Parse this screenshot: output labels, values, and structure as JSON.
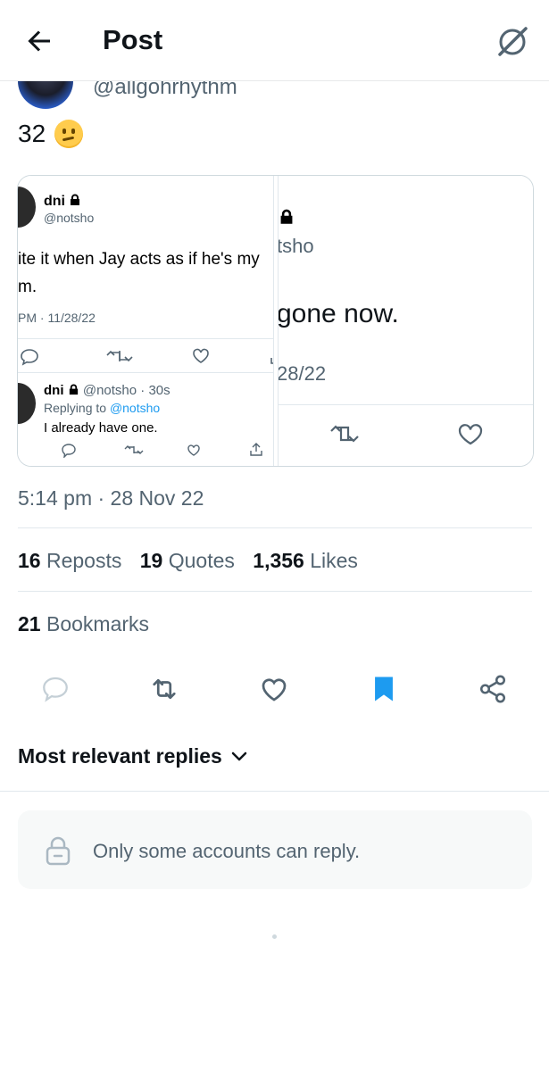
{
  "header": {
    "title": "Post",
    "back_icon": "arrow-left-icon",
    "grok_icon": "grok-icon"
  },
  "tweet": {
    "handle": "@allgohrhythm",
    "text": "32",
    "emoji": "confused-face-emoji",
    "timestamp": "5:14 pm · 28 Nov 22"
  },
  "media_left": {
    "name": "dni",
    "handle": "@notsho",
    "text_lines": [
      "ite it when Jay acts as if he's my",
      "m."
    ],
    "time": "PM · 11/28/22",
    "reply": {
      "name": "dni",
      "meta": "@notsho · 30s",
      "replying_prefix": "Replying to",
      "replying_to": "@notsho",
      "text": "I already have one."
    }
  },
  "media_right": {
    "handle": "tsho",
    "text": "gone now.",
    "date": "28/22"
  },
  "stats": {
    "reposts_count": "16",
    "reposts_label": "Reposts",
    "quotes_count": "19",
    "quotes_label": "Quotes",
    "likes_count": "1,356",
    "likes_label": "Likes",
    "bookmarks_count": "21",
    "bookmarks_label": "Bookmarks"
  },
  "actions": [
    "reply-icon",
    "repost-icon",
    "like-icon",
    "bookmark-icon",
    "share-icon"
  ],
  "replies": {
    "sort_label": "Most relevant replies",
    "restriction_text": "Only some accounts can reply."
  },
  "colors": {
    "accent": "#1d9bf0",
    "secondary_text": "#536471",
    "primary_text": "#0f1419"
  }
}
